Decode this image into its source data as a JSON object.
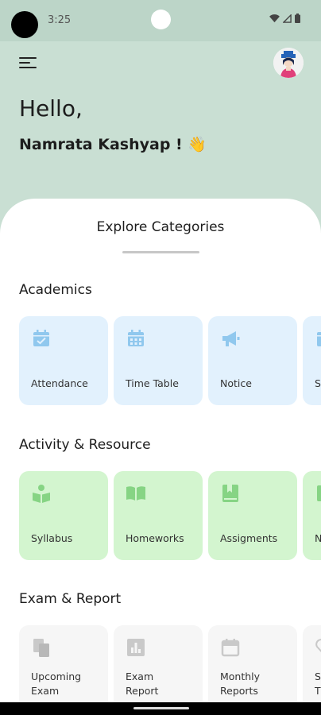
{
  "status_bar": {
    "time": "3:25"
  },
  "header": {
    "greeting": "Hello,",
    "user_name": "Namrata Kashyap ! 👋"
  },
  "sheet": {
    "title": "Explore Categories"
  },
  "sections": [
    {
      "title": "Academics",
      "color": "#e2f1fd",
      "icon_color": "#90c8ee",
      "items": [
        {
          "label": "Attendance",
          "icon": "calendar-check-icon"
        },
        {
          "label": "Time Table",
          "icon": "calendar-grid-icon"
        },
        {
          "label": "Notice",
          "icon": "megaphone-icon"
        },
        {
          "label": "S",
          "icon": "calendar-icon"
        }
      ]
    },
    {
      "title": "Activity & Resource",
      "color": "#d3f5cf",
      "icon_color": "#86d484",
      "items": [
        {
          "label": "Syllabus",
          "icon": "reader-icon"
        },
        {
          "label": "Homeworks",
          "icon": "open-book-icon"
        },
        {
          "label": "Assigments",
          "icon": "bookmark-book-icon"
        },
        {
          "label": "N",
          "icon": "book-icon"
        }
      ]
    },
    {
      "title": "Exam & Report",
      "color": "#f6f6f6",
      "icon_color": "#c9c9c9",
      "items": [
        {
          "label_line1": "Upcoming",
          "label_line2": "Exam",
          "icon": "copy-files-icon"
        },
        {
          "label_line1": "Exam",
          "label_line2": "Report",
          "icon": "bar-chart-icon"
        },
        {
          "label_line1": "Monthly",
          "label_line2": "Reports",
          "icon": "calendar-icon"
        },
        {
          "label_line1": "S",
          "label_line2": "T",
          "icon": "heart-icon"
        }
      ]
    }
  ]
}
